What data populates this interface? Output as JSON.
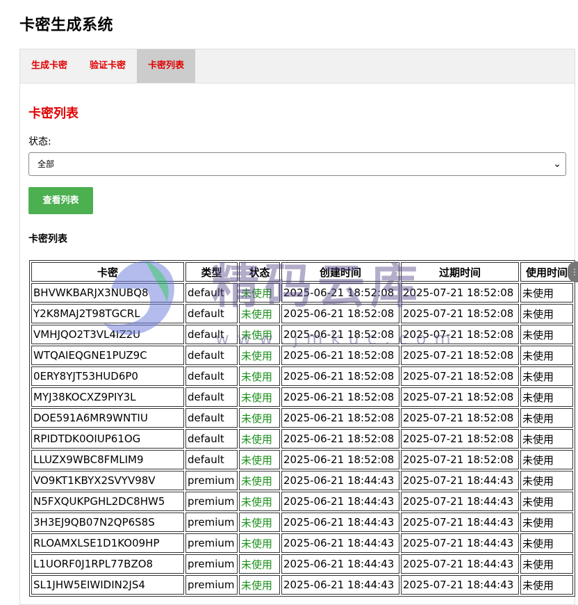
{
  "page": {
    "title": "卡密生成系统"
  },
  "tabs": [
    {
      "label": "生成卡密",
      "active": false
    },
    {
      "label": "验证卡密",
      "active": false
    },
    {
      "label": "卡密列表",
      "active": true
    }
  ],
  "section": {
    "title": "卡密列表",
    "status_label": "状态:",
    "status_value": "全部",
    "view_button": "查看列表",
    "list_title": "卡密列表"
  },
  "table": {
    "headers": [
      "卡密",
      "类型",
      "状态",
      "创建时间",
      "过期时间",
      "使用时间"
    ],
    "rows": [
      [
        "BHVWKBARJX3NUBQ8",
        "default",
        "未使用",
        "2025-06-21 18:52:08",
        "2025-07-21 18:52:08",
        "未使用"
      ],
      [
        "Y2K8MAJ2T98TGCRL",
        "default",
        "未使用",
        "2025-06-21 18:52:08",
        "2025-07-21 18:52:08",
        "未使用"
      ],
      [
        "VMHJQO2T3VL4IZ2U",
        "default",
        "未使用",
        "2025-06-21 18:52:08",
        "2025-07-21 18:52:08",
        "未使用"
      ],
      [
        "WTQAIEQGNE1PUZ9C",
        "default",
        "未使用",
        "2025-06-21 18:52:08",
        "2025-07-21 18:52:08",
        "未使用"
      ],
      [
        "0ERY8YJT53HUD6P0",
        "default",
        "未使用",
        "2025-06-21 18:52:08",
        "2025-07-21 18:52:08",
        "未使用"
      ],
      [
        "MYJ38KOCXZ9PIY3L",
        "default",
        "未使用",
        "2025-06-21 18:52:08",
        "2025-07-21 18:52:08",
        "未使用"
      ],
      [
        "DOE591A6MR9WNTIU",
        "default",
        "未使用",
        "2025-06-21 18:52:08",
        "2025-07-21 18:52:08",
        "未使用"
      ],
      [
        "RPIDTDK0OIUP61OG",
        "default",
        "未使用",
        "2025-06-21 18:52:08",
        "2025-07-21 18:52:08",
        "未使用"
      ],
      [
        "LLUZX9WBC8FMLIM9",
        "default",
        "未使用",
        "2025-06-21 18:52:08",
        "2025-07-21 18:52:08",
        "未使用"
      ],
      [
        "VO9KT1KBYX2SVYV98V",
        "premium",
        "未使用",
        "2025-06-21 18:44:43",
        "2025-07-21 18:44:43",
        "未使用"
      ],
      [
        "N5FXQUKPGHL2DC8HW5",
        "premium",
        "未使用",
        "2025-06-21 18:44:43",
        "2025-07-21 18:44:43",
        "未使用"
      ],
      [
        "3H3EJ9QB07N2QP6S8S",
        "premium",
        "未使用",
        "2025-06-21 18:44:43",
        "2025-07-21 18:44:43",
        "未使用"
      ],
      [
        "RLOAMXLSE1D1KO09HP",
        "premium",
        "未使用",
        "2025-06-21 18:44:43",
        "2025-07-21 18:44:43",
        "未使用"
      ],
      [
        "L1UORF0J1RPL77BZO8",
        "premium",
        "未使用",
        "2025-06-21 18:44:43",
        "2025-07-21 18:44:43",
        "未使用"
      ],
      [
        "SL1JHW5EIWIDIN2JS4",
        "premium",
        "未使用",
        "2025-06-21 18:44:43",
        "2025-07-21 18:44:43",
        "未使用"
      ]
    ]
  },
  "watermark": {
    "text": "精码云库",
    "url": "www.jmkuc.com"
  },
  "colors": {
    "accent_red": "#e00000",
    "button_green": "#4caf50",
    "status_green": "#1a8f1a",
    "tab_bg": "#f1f1f1",
    "tab_active_bg": "#cccccc"
  }
}
